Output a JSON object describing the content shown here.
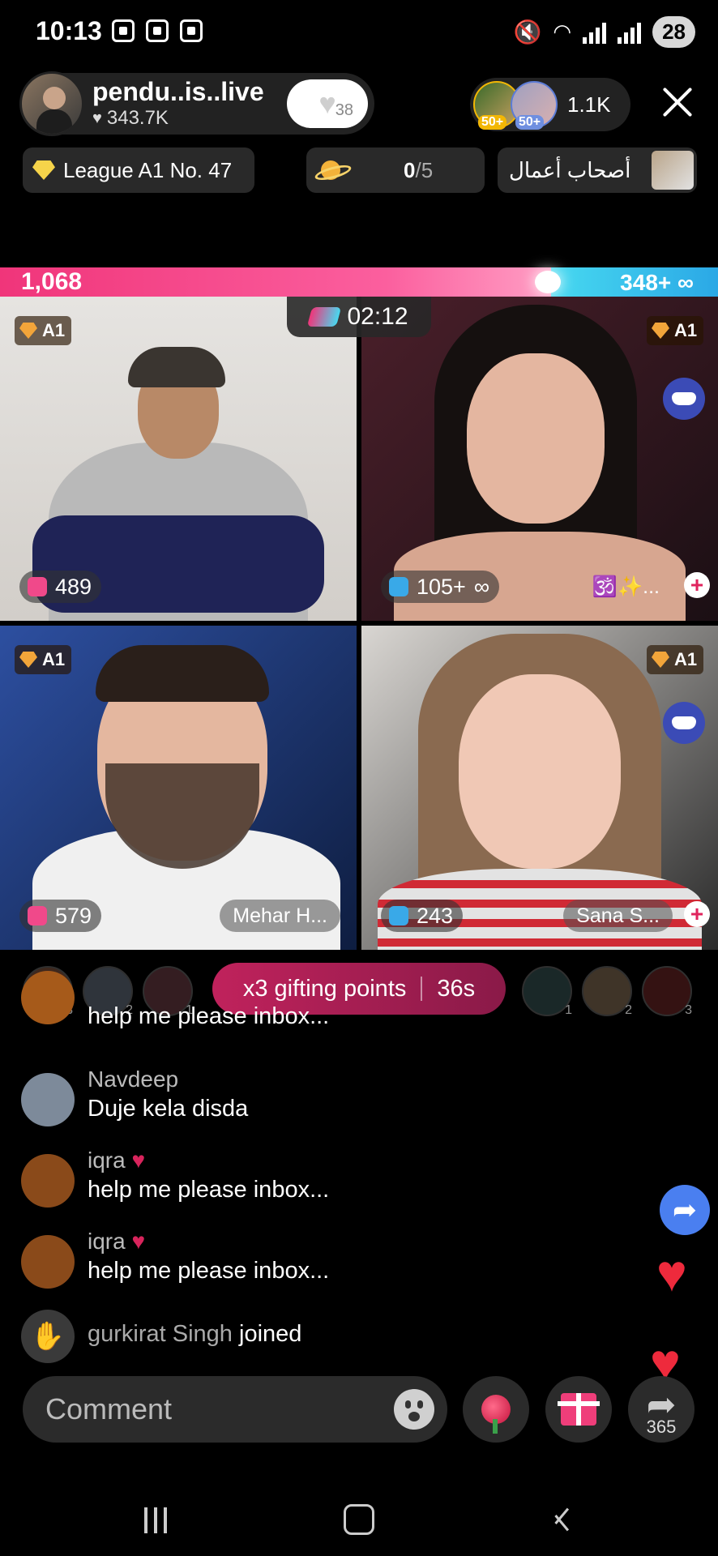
{
  "status_bar": {
    "time": "10:13",
    "battery": "28"
  },
  "host": {
    "name": "pendu..is..live",
    "likes": "343.7K",
    "follow_badge": "38"
  },
  "viewers": {
    "badge_1": "50+",
    "badge_2": "50+",
    "count": "1.1K"
  },
  "pills": {
    "league": "League A1 No. 47",
    "planet_current": "0",
    "planet_total": "/5",
    "arabic": "أصحاب أعمال"
  },
  "battle": {
    "left_score": "1,068",
    "right_score": "348+",
    "timer": "02:12"
  },
  "tiles": [
    {
      "rank": "A1",
      "score": "489",
      "name": "",
      "team": "red"
    },
    {
      "rank": "A1",
      "score": "105+",
      "name": "🕉️✨...",
      "team": "blue"
    },
    {
      "rank": "A1",
      "score": "579",
      "name": "Mehar H...",
      "team": "red"
    },
    {
      "rank": "A1",
      "score": "243",
      "name": "Sana S...",
      "team": "blue"
    }
  ],
  "gifting": {
    "label": "x3 gifting points",
    "countdown": "36s",
    "left_ranks": [
      "3",
      "2",
      "1"
    ],
    "right_ranks": [
      "1",
      "2",
      "3"
    ]
  },
  "chat": [
    {
      "name": "",
      "text": "help me please inbox..."
    },
    {
      "name": "Navdeep",
      "text": "Duje kela disda"
    },
    {
      "name": "iqra",
      "text": "help me please inbox..."
    },
    {
      "name": "iqra",
      "text": "help me please inbox..."
    }
  ],
  "joined": {
    "user": "gurkirat Singh",
    "action": "joined"
  },
  "bottom": {
    "comment_placeholder": "Comment",
    "share_count": "365"
  },
  "colors": {
    "pink": "#f0357a",
    "cyan": "#47d9f0",
    "gift_pill": "#c0225c",
    "share_blue": "#4a7ff0"
  }
}
